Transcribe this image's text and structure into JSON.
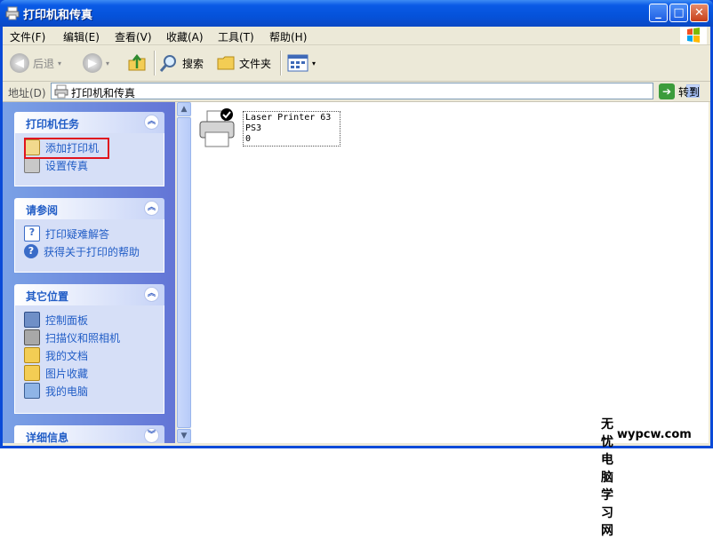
{
  "window": {
    "title": "打印机和传真"
  },
  "menubar": {
    "items": [
      "文件(F)",
      "编辑(E)",
      "查看(V)",
      "收藏(A)",
      "工具(T)",
      "帮助(H)"
    ]
  },
  "toolbar": {
    "back_label": "后退",
    "search_label": "搜索",
    "folders_label": "文件夹"
  },
  "address": {
    "label": "地址(D)",
    "value": "打印机和传真",
    "go_label": "转到"
  },
  "sidebar": {
    "printer_tasks": {
      "title": "打印机任务",
      "items": [
        "添加打印机",
        "设置传真"
      ]
    },
    "see_also": {
      "title": "请参阅",
      "items": [
        "打印疑难解答",
        "获得关于打印的帮助"
      ]
    },
    "other_places": {
      "title": "其它位置",
      "items": [
        "控制面板",
        "扫描仪和照相机",
        "我的文档",
        "图片收藏",
        "我的电脑"
      ]
    },
    "details": {
      "title": "详细信息"
    }
  },
  "content": {
    "printer_name_line1": "Laser Printer 63",
    "printer_name_line2": "PS3",
    "printer_name_line3": "0"
  },
  "watermark": {
    "line1": "无忧电脑学习网",
    "line2": "wypcw.com"
  },
  "colors": {
    "title_bar": "#0552da",
    "task_link": "#215dc6",
    "highlight_box": "#e0141e"
  }
}
